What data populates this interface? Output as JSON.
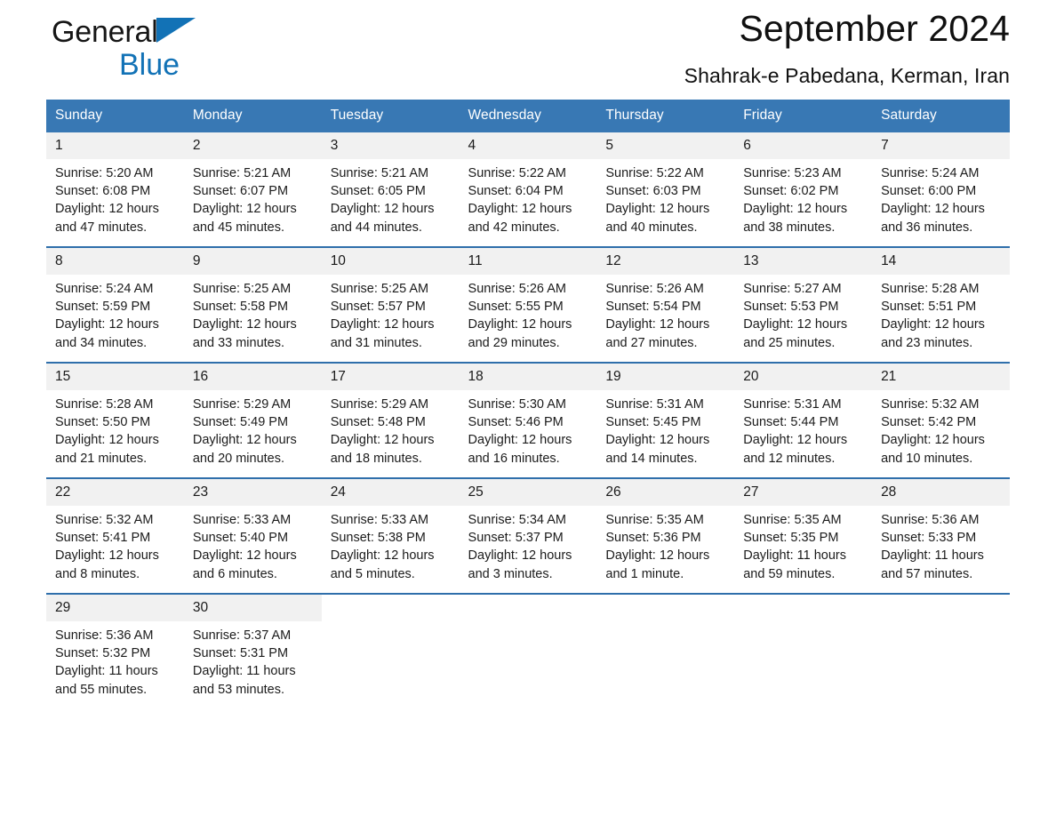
{
  "brand": {
    "word_black": "General",
    "word_blue": "Blue",
    "triangle_color": "#1272b6"
  },
  "header": {
    "title": "September 2024",
    "subtitle": "Shahrak-e Pabedana, Kerman, Iran"
  },
  "colors": {
    "header_blue": "#3878b4",
    "row_rule_blue": "#2f6fab",
    "daynum_band": "#f1f1f1",
    "text": "#1a1a1a"
  },
  "weekdays": [
    "Sunday",
    "Monday",
    "Tuesday",
    "Wednesday",
    "Thursday",
    "Friday",
    "Saturday"
  ],
  "days": [
    {
      "n": "1",
      "sunrise": "Sunrise: 5:20 AM",
      "sunset": "Sunset: 6:08 PM",
      "daylight1": "Daylight: 12 hours",
      "daylight2": "and 47 minutes."
    },
    {
      "n": "2",
      "sunrise": "Sunrise: 5:21 AM",
      "sunset": "Sunset: 6:07 PM",
      "daylight1": "Daylight: 12 hours",
      "daylight2": "and 45 minutes."
    },
    {
      "n": "3",
      "sunrise": "Sunrise: 5:21 AM",
      "sunset": "Sunset: 6:05 PM",
      "daylight1": "Daylight: 12 hours",
      "daylight2": "and 44 minutes."
    },
    {
      "n": "4",
      "sunrise": "Sunrise: 5:22 AM",
      "sunset": "Sunset: 6:04 PM",
      "daylight1": "Daylight: 12 hours",
      "daylight2": "and 42 minutes."
    },
    {
      "n": "5",
      "sunrise": "Sunrise: 5:22 AM",
      "sunset": "Sunset: 6:03 PM",
      "daylight1": "Daylight: 12 hours",
      "daylight2": "and 40 minutes."
    },
    {
      "n": "6",
      "sunrise": "Sunrise: 5:23 AM",
      "sunset": "Sunset: 6:02 PM",
      "daylight1": "Daylight: 12 hours",
      "daylight2": "and 38 minutes."
    },
    {
      "n": "7",
      "sunrise": "Sunrise: 5:24 AM",
      "sunset": "Sunset: 6:00 PM",
      "daylight1": "Daylight: 12 hours",
      "daylight2": "and 36 minutes."
    },
    {
      "n": "8",
      "sunrise": "Sunrise: 5:24 AM",
      "sunset": "Sunset: 5:59 PM",
      "daylight1": "Daylight: 12 hours",
      "daylight2": "and 34 minutes."
    },
    {
      "n": "9",
      "sunrise": "Sunrise: 5:25 AM",
      "sunset": "Sunset: 5:58 PM",
      "daylight1": "Daylight: 12 hours",
      "daylight2": "and 33 minutes."
    },
    {
      "n": "10",
      "sunrise": "Sunrise: 5:25 AM",
      "sunset": "Sunset: 5:57 PM",
      "daylight1": "Daylight: 12 hours",
      "daylight2": "and 31 minutes."
    },
    {
      "n": "11",
      "sunrise": "Sunrise: 5:26 AM",
      "sunset": "Sunset: 5:55 PM",
      "daylight1": "Daylight: 12 hours",
      "daylight2": "and 29 minutes."
    },
    {
      "n": "12",
      "sunrise": "Sunrise: 5:26 AM",
      "sunset": "Sunset: 5:54 PM",
      "daylight1": "Daylight: 12 hours",
      "daylight2": "and 27 minutes."
    },
    {
      "n": "13",
      "sunrise": "Sunrise: 5:27 AM",
      "sunset": "Sunset: 5:53 PM",
      "daylight1": "Daylight: 12 hours",
      "daylight2": "and 25 minutes."
    },
    {
      "n": "14",
      "sunrise": "Sunrise: 5:28 AM",
      "sunset": "Sunset: 5:51 PM",
      "daylight1": "Daylight: 12 hours",
      "daylight2": "and 23 minutes."
    },
    {
      "n": "15",
      "sunrise": "Sunrise: 5:28 AM",
      "sunset": "Sunset: 5:50 PM",
      "daylight1": "Daylight: 12 hours",
      "daylight2": "and 21 minutes."
    },
    {
      "n": "16",
      "sunrise": "Sunrise: 5:29 AM",
      "sunset": "Sunset: 5:49 PM",
      "daylight1": "Daylight: 12 hours",
      "daylight2": "and 20 minutes."
    },
    {
      "n": "17",
      "sunrise": "Sunrise: 5:29 AM",
      "sunset": "Sunset: 5:48 PM",
      "daylight1": "Daylight: 12 hours",
      "daylight2": "and 18 minutes."
    },
    {
      "n": "18",
      "sunrise": "Sunrise: 5:30 AM",
      "sunset": "Sunset: 5:46 PM",
      "daylight1": "Daylight: 12 hours",
      "daylight2": "and 16 minutes."
    },
    {
      "n": "19",
      "sunrise": "Sunrise: 5:31 AM",
      "sunset": "Sunset: 5:45 PM",
      "daylight1": "Daylight: 12 hours",
      "daylight2": "and 14 minutes."
    },
    {
      "n": "20",
      "sunrise": "Sunrise: 5:31 AM",
      "sunset": "Sunset: 5:44 PM",
      "daylight1": "Daylight: 12 hours",
      "daylight2": "and 12 minutes."
    },
    {
      "n": "21",
      "sunrise": "Sunrise: 5:32 AM",
      "sunset": "Sunset: 5:42 PM",
      "daylight1": "Daylight: 12 hours",
      "daylight2": "and 10 minutes."
    },
    {
      "n": "22",
      "sunrise": "Sunrise: 5:32 AM",
      "sunset": "Sunset: 5:41 PM",
      "daylight1": "Daylight: 12 hours",
      "daylight2": "and 8 minutes."
    },
    {
      "n": "23",
      "sunrise": "Sunrise: 5:33 AM",
      "sunset": "Sunset: 5:40 PM",
      "daylight1": "Daylight: 12 hours",
      "daylight2": "and 6 minutes."
    },
    {
      "n": "24",
      "sunrise": "Sunrise: 5:33 AM",
      "sunset": "Sunset: 5:38 PM",
      "daylight1": "Daylight: 12 hours",
      "daylight2": "and 5 minutes."
    },
    {
      "n": "25",
      "sunrise": "Sunrise: 5:34 AM",
      "sunset": "Sunset: 5:37 PM",
      "daylight1": "Daylight: 12 hours",
      "daylight2": "and 3 minutes."
    },
    {
      "n": "26",
      "sunrise": "Sunrise: 5:35 AM",
      "sunset": "Sunset: 5:36 PM",
      "daylight1": "Daylight: 12 hours",
      "daylight2": "and 1 minute."
    },
    {
      "n": "27",
      "sunrise": "Sunrise: 5:35 AM",
      "sunset": "Sunset: 5:35 PM",
      "daylight1": "Daylight: 11 hours",
      "daylight2": "and 59 minutes."
    },
    {
      "n": "28",
      "sunrise": "Sunrise: 5:36 AM",
      "sunset": "Sunset: 5:33 PM",
      "daylight1": "Daylight: 11 hours",
      "daylight2": "and 57 minutes."
    },
    {
      "n": "29",
      "sunrise": "Sunrise: 5:36 AM",
      "sunset": "Sunset: 5:32 PM",
      "daylight1": "Daylight: 11 hours",
      "daylight2": "and 55 minutes."
    },
    {
      "n": "30",
      "sunrise": "Sunrise: 5:37 AM",
      "sunset": "Sunset: 5:31 PM",
      "daylight1": "Daylight: 11 hours",
      "daylight2": "and 53 minutes."
    }
  ]
}
